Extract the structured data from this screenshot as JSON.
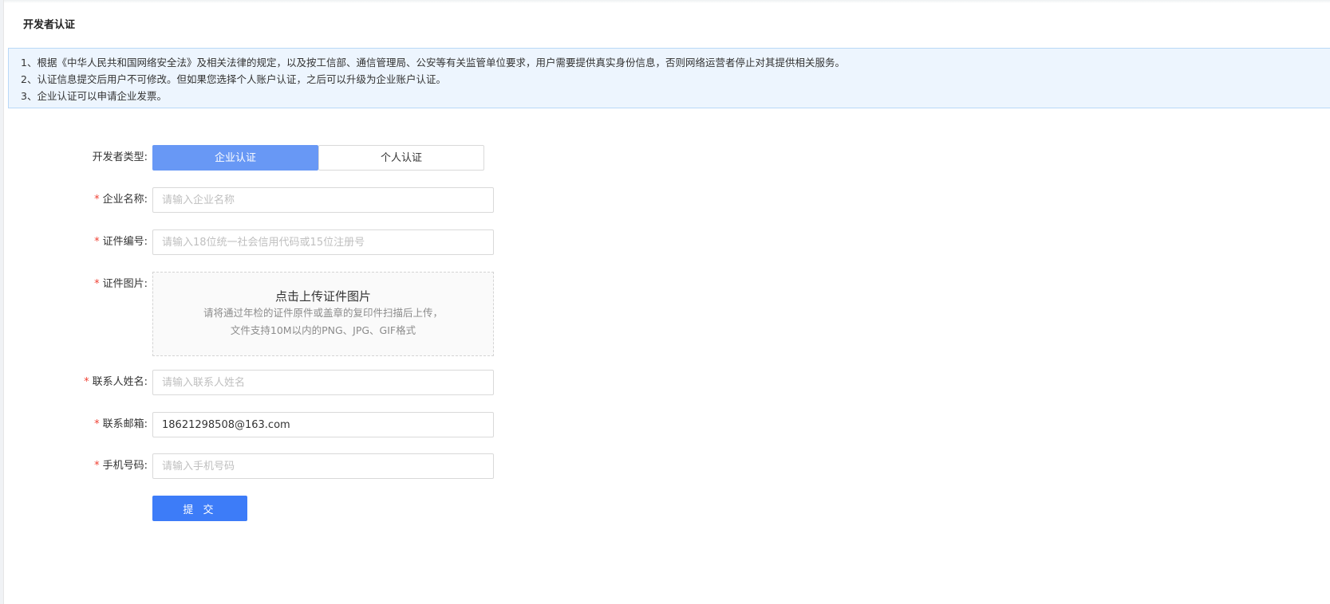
{
  "page": {
    "title": "开发者认证"
  },
  "notice": {
    "lines": [
      "1、根据《中华人民共和国网络安全法》及相关法律的规定，以及按工信部、通信管理局、公安等有关监管单位要求，用户需要提供真实身份信息，否则网络运营者停止对其提供相关服务。",
      "2、认证信息提交后用户不可修改。但如果您选择个人账户认证，之后可以升级为企业账户认证。",
      "3、企业认证可以申请企业发票。"
    ]
  },
  "form": {
    "developer_type": {
      "label": "开发者类型:",
      "options": [
        "企业认证",
        "个人认证"
      ],
      "selected": "企业认证"
    },
    "company_name": {
      "required_mark": "*",
      "label": "企业名称:",
      "value": "",
      "placeholder": "请输入企业名称"
    },
    "license_number": {
      "required_mark": "*",
      "label": "证件编号:",
      "value": "",
      "placeholder": "请输入18位统一社会信用代码或15位注册号"
    },
    "license_image": {
      "required_mark": "*",
      "label": "证件图片:",
      "upload_title": "点击上传证件图片",
      "upload_hint_1": "请将通过年检的证件原件或盖章的复印件扫描后上传，",
      "upload_hint_2": "文件支持10M以内的PNG、JPG、GIF格式"
    },
    "contact_name": {
      "required_mark": "*",
      "label": "联系人姓名:",
      "value": "",
      "placeholder": "请输入联系人姓名"
    },
    "contact_email": {
      "required_mark": "*",
      "label": "联系邮箱:",
      "value": "18621298508@163.com",
      "placeholder": ""
    },
    "phone": {
      "required_mark": "*",
      "label": "手机号码:",
      "value": "",
      "placeholder": "请输入手机号码"
    },
    "submit_label": "提 交"
  },
  "colors": {
    "primary": "#3d7cf8",
    "selected_type": "#6898f5",
    "notice_bg": "#edf5fe",
    "notice_border": "#b9d8f7",
    "required": "#f04134"
  }
}
